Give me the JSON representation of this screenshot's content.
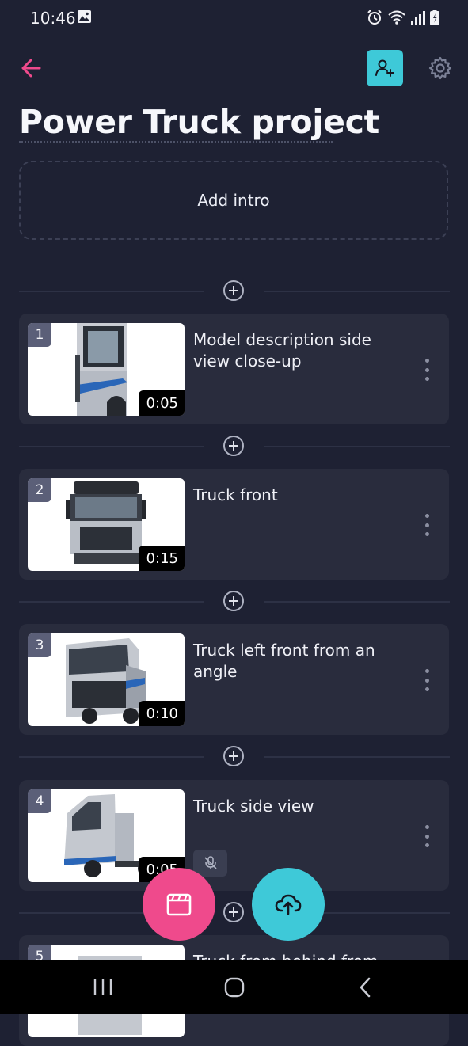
{
  "status_bar": {
    "time": "10:46",
    "icons": [
      "image-icon",
      "alarm-icon",
      "wifi-icon",
      "signal-icon",
      "battery-icon"
    ]
  },
  "header": {
    "back_icon": "arrow-left-icon",
    "invite_icon": "add-person-icon",
    "settings_icon": "gear-icon",
    "title": "Power Truck project"
  },
  "intro": {
    "label": "Add intro"
  },
  "clips": [
    {
      "number": "1",
      "title": "Model description side view close-up",
      "duration": "0:05",
      "muted": false
    },
    {
      "number": "2",
      "title": "Truck front",
      "duration": "0:15",
      "muted": false
    },
    {
      "number": "3",
      "title": "Truck left front from an angle",
      "duration": "0:10",
      "muted": false
    },
    {
      "number": "4",
      "title": "Truck side view",
      "duration": "0:05",
      "muted": true
    },
    {
      "number": "5",
      "title": "Truck from behind from an",
      "duration": "",
      "muted": false
    }
  ],
  "fabs": {
    "record_icon": "clapperboard-icon",
    "upload_icon": "cloud-upload-icon"
  },
  "colors": {
    "accent_pink": "#ef4a8c",
    "accent_cyan": "#3ec9d8",
    "background": "#1e2133",
    "card": "#292c3d"
  },
  "nav_bar": {
    "icons": [
      "recents-icon",
      "home-icon",
      "back-icon"
    ]
  }
}
